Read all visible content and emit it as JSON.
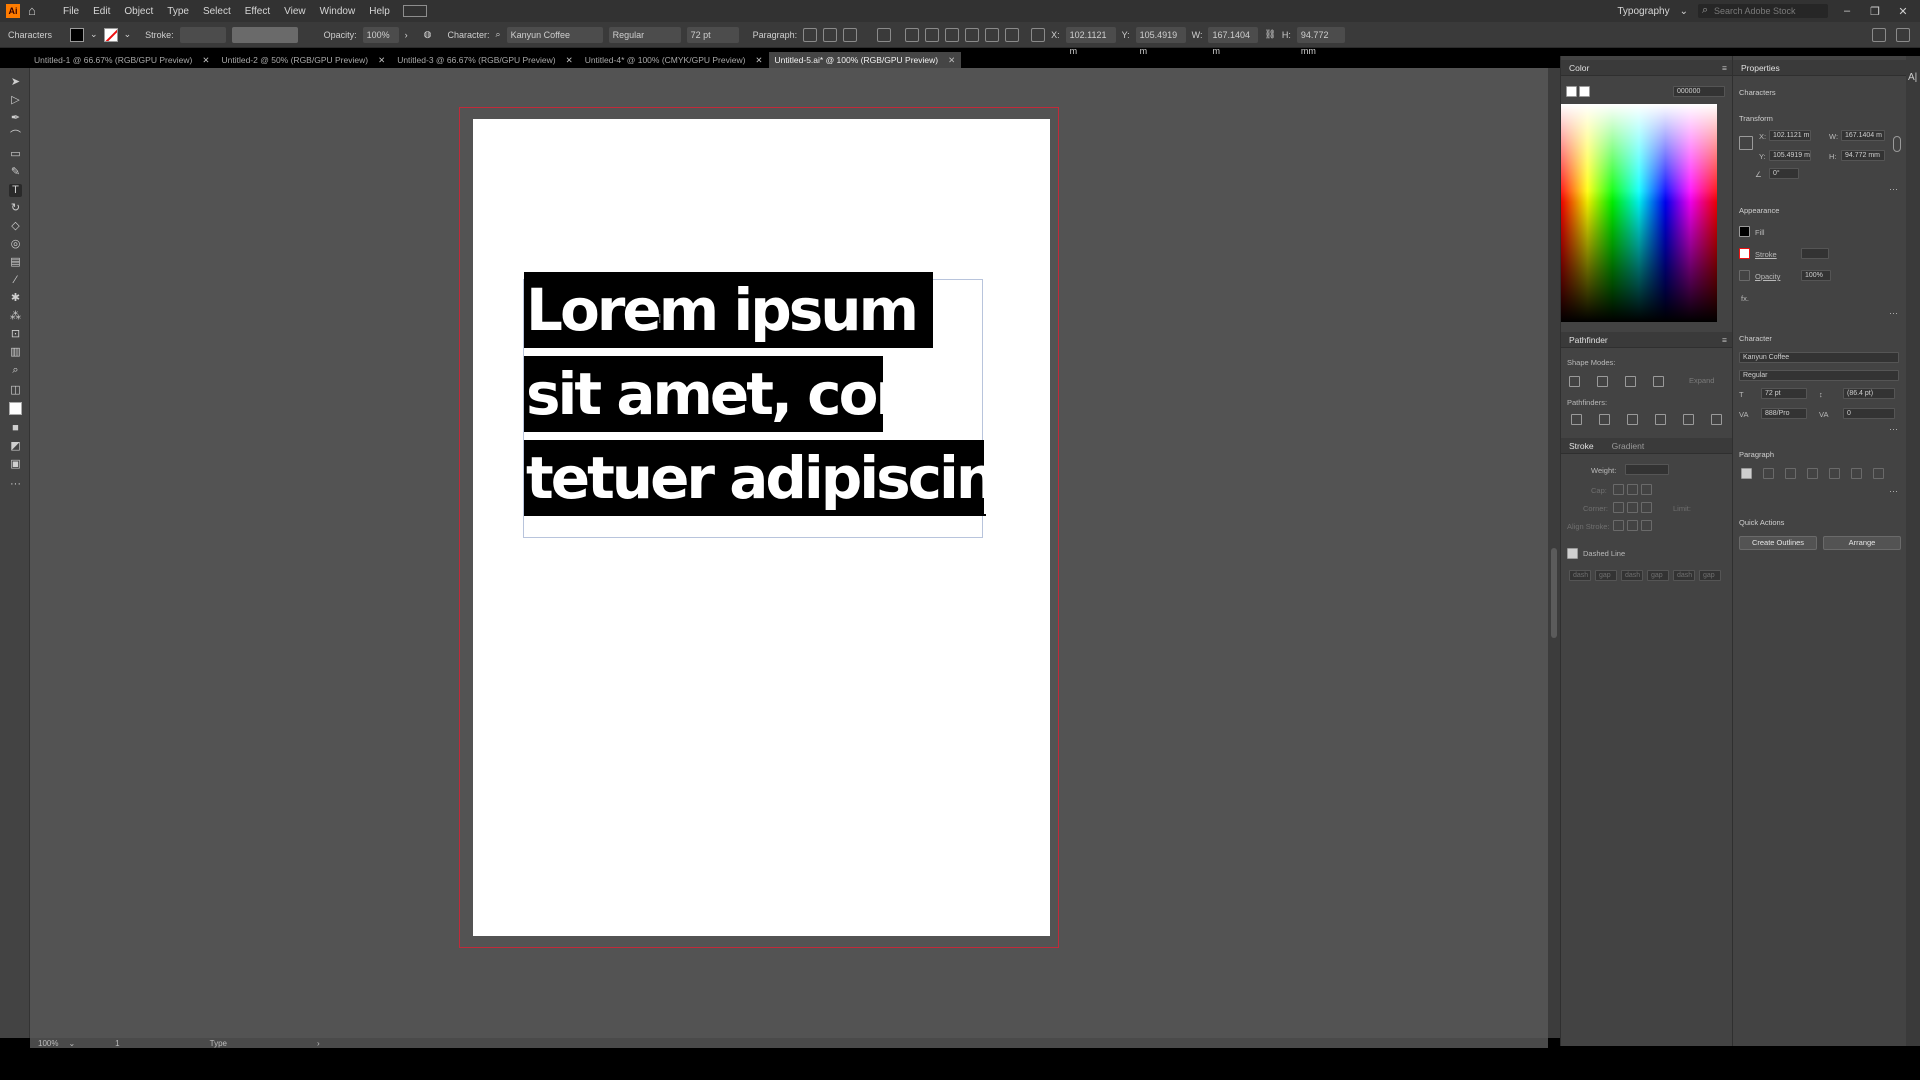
{
  "menubar": {
    "items": [
      "File",
      "Edit",
      "Object",
      "Type",
      "Select",
      "Effect",
      "View",
      "Window",
      "Help"
    ],
    "workspace": "Typography",
    "search_placeholder": "Search Adobe Stock"
  },
  "controlbar": {
    "mode_label": "Characters",
    "stroke_label": "Stroke:",
    "opacity_label": "Opacity:",
    "opacity_value": "100%",
    "character_label": "Character:",
    "font_family": "Kanyun Coffee",
    "font_style": "Regular",
    "font_size": "72 pt",
    "paragraph_label": "Paragraph:",
    "x_value": "102.1121 m",
    "y_value": "105.4919 m",
    "w_value": "167.1404 m",
    "h_value": "94.772 mm"
  },
  "tabs": [
    {
      "label": "Untitled-1 @ 66.67% (RGB/GPU Preview)",
      "active": false
    },
    {
      "label": "Untitled-2 @ 50% (RGB/GPU Preview)",
      "active": false
    },
    {
      "label": "Untitled-3 @ 66.67% (RGB/GPU Preview)",
      "active": false
    },
    {
      "label": "Untitled-4* @ 100% (CMYK/GPU Preview)",
      "active": false
    },
    {
      "label": "Untitled-5.ai* @ 100% (RGB/GPU Preview)",
      "active": true
    }
  ],
  "canvas": {
    "lines": [
      "Lorem ipsum dolor",
      "sit amet, consec-",
      "tetuer adipiscing elit,"
    ]
  },
  "statusbar": {
    "zoom": "100%",
    "page": "1",
    "tool": "Type"
  },
  "color_panel": {
    "title": "Color",
    "hex": "000000"
  },
  "pathfinder_panel": {
    "title": "Pathfinder",
    "shape_modes_label": "Shape Modes:",
    "pathfinders_label": "Pathfinders:",
    "expand_label": "Expand"
  },
  "stroke_panel": {
    "title": "Stroke",
    "gradient_tab": "Gradient",
    "weight_label": "Weight:",
    "cap_label": "Cap:",
    "corner_label": "Corner:",
    "limit_label": "Limit:",
    "align_label": "Align Stroke:",
    "dashed_label": "Dashed Line",
    "dash_labels": [
      "dash",
      "gap",
      "dash",
      "gap",
      "dash",
      "gap"
    ]
  },
  "properties": {
    "title": "Properties",
    "subtitle": "Characters",
    "transform_label": "Transform",
    "x": "102.1121 m",
    "y": "105.4919 m",
    "w": "167.1404 m",
    "h": "94.772 mm",
    "angle": "0°",
    "appearance_label": "Appearance",
    "fill_label": "Fill",
    "stroke_label": "Stroke",
    "opacity_label": "Opacity",
    "opacity_value": "100%",
    "fx_label": "fx.",
    "character_label": "Character",
    "font_family": "Kanyun Coffee",
    "font_style": "Regular",
    "font_size": "72 pt",
    "leading": "(86.4 pt)",
    "kerning": "888/Pro",
    "tracking": "0",
    "paragraph_label": "Paragraph",
    "quick_actions_label": "Quick Actions",
    "create_outlines": "Create Outlines",
    "arrange": "Arrange"
  },
  "colors": {
    "accent_orange": "#ff7c00",
    "artboard_bleed": "#c22a3a",
    "canvas_bg": "#535353",
    "selection_bg": "#000000"
  }
}
